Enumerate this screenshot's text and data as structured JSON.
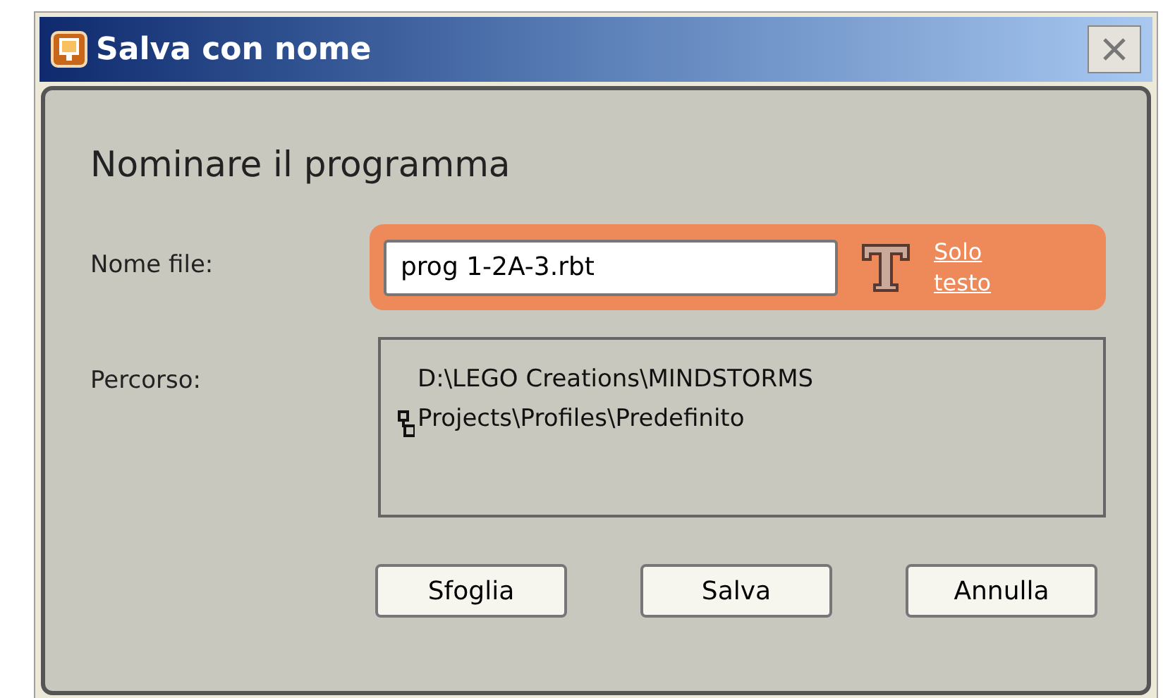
{
  "window": {
    "title": "Salva con nome"
  },
  "heading": "Nominare il programma",
  "name_field": {
    "label": "Nome file:",
    "value": "prog 1-2A-3.rbt",
    "link": "Solo testo"
  },
  "path": {
    "label": "Percorso:",
    "value": "D:\\LEGO Creations\\MINDSTORMS Projects\\Profiles\\Predefinito"
  },
  "buttons": [
    "Sfoglia",
    "Salva",
    "Annulla"
  ]
}
